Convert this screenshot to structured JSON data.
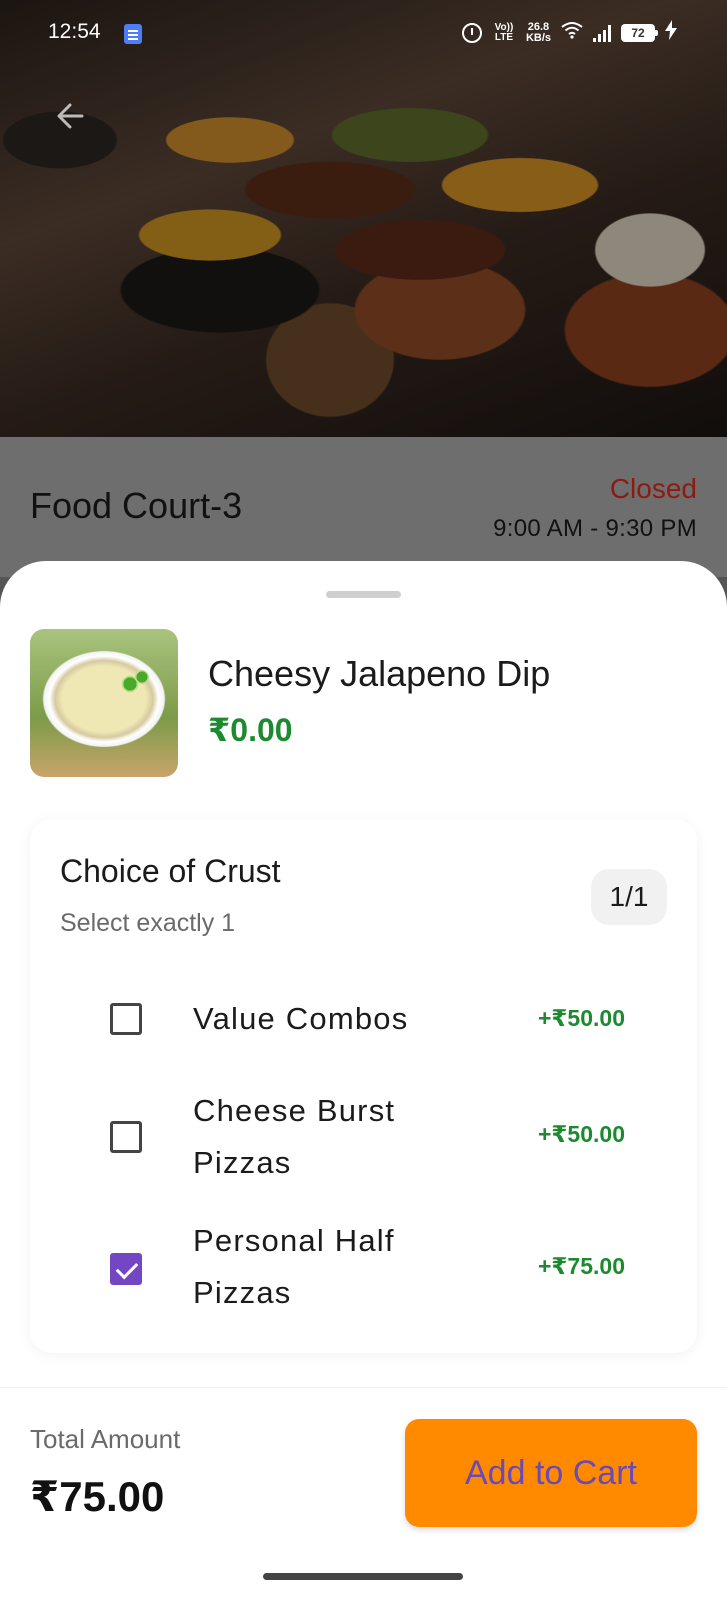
{
  "status_bar": {
    "time": "12:54",
    "volte": "Vo)) LTE",
    "net_speed_value": "26.8",
    "net_speed_unit": "KB/s",
    "battery": "72"
  },
  "venue": {
    "name": "Food Court-3",
    "status": "Closed",
    "hours": "9:00 AM - 9:30 PM",
    "status_color": "#8e1a12"
  },
  "item": {
    "name": "Cheesy Jalapeno Dip",
    "price": "₹0.00"
  },
  "choice_group": {
    "title": "Choice of Crust",
    "subtitle": "Select exactly 1",
    "count": "1/1",
    "options": [
      {
        "label": "Value Combos",
        "price": "+₹50.00",
        "checked": false
      },
      {
        "label": "Cheese Burst Pizzas",
        "price": "+₹50.00",
        "checked": false
      },
      {
        "label": "Personal Half Pizzas",
        "price": "+₹75.00",
        "checked": true
      }
    ]
  },
  "footer": {
    "total_label": "Total Amount",
    "total_value": "₹75.00",
    "cart_button_label": "Add to Cart"
  },
  "colors": {
    "accent_orange": "#ff8a00",
    "checkbox_purple": "#7347c4",
    "price_green": "#1e8a2f"
  },
  "icons": [
    "back-arrow-icon",
    "doc-icon",
    "alarm-icon",
    "wifi-icon",
    "signal-icon",
    "battery-icon",
    "charging-bolt-icon",
    "checkbox-icon"
  ]
}
